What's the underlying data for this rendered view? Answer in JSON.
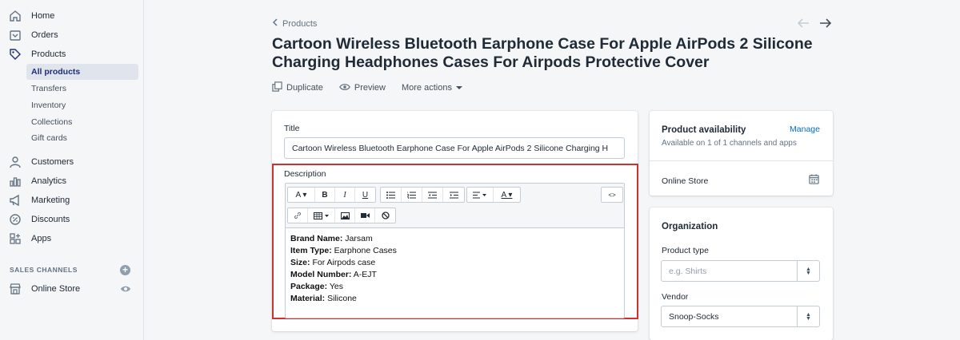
{
  "sidebar": {
    "home": "Home",
    "orders": "Orders",
    "products": "Products",
    "sub_items": [
      "All products",
      "Transfers",
      "Inventory",
      "Collections",
      "Gift cards"
    ],
    "customers": "Customers",
    "analytics": "Analytics",
    "marketing": "Marketing",
    "discounts": "Discounts",
    "apps": "Apps",
    "sales_channels_heading": "SALES CHANNELS",
    "online_store": "Online Store"
  },
  "header": {
    "breadcrumb": "Products",
    "title": "Cartoon Wireless Bluetooth Earphone Case For Apple AirPods 2 Silicone Charging Headphones Cases For Airpods Protective Cover",
    "actions": {
      "duplicate": "Duplicate",
      "preview": "Preview",
      "more": "More actions"
    }
  },
  "form": {
    "title_label": "Title",
    "title_value": "Cartoon Wireless Bluetooth Earphone Case For Apple AirPods 2 Silicone Charging H",
    "description_label": "Description",
    "description": [
      {
        "key": "Brand Name:",
        "value": "Jarsam"
      },
      {
        "key": "Item Type:",
        "value": "Earphone Cases"
      },
      {
        "key": "Size:",
        "value": "For Airpods case"
      },
      {
        "key": "Model Number:",
        "value": "A-EJT"
      },
      {
        "key": "Package:",
        "value": "Yes"
      },
      {
        "key": "Material:",
        "value": "Silicone"
      }
    ]
  },
  "availability": {
    "heading": "Product availability",
    "manage": "Manage",
    "subtext": "Available on 1 of 1 channels and apps",
    "channel": "Online Store"
  },
  "organization": {
    "heading": "Organization",
    "product_type_label": "Product type",
    "product_type_placeholder": "e.g. Shirts",
    "vendor_label": "Vendor",
    "vendor_value": "Snoop-Socks"
  },
  "colors": {
    "accent": "#202e78",
    "highlight": "#d0312d",
    "link": "#006fbb"
  }
}
